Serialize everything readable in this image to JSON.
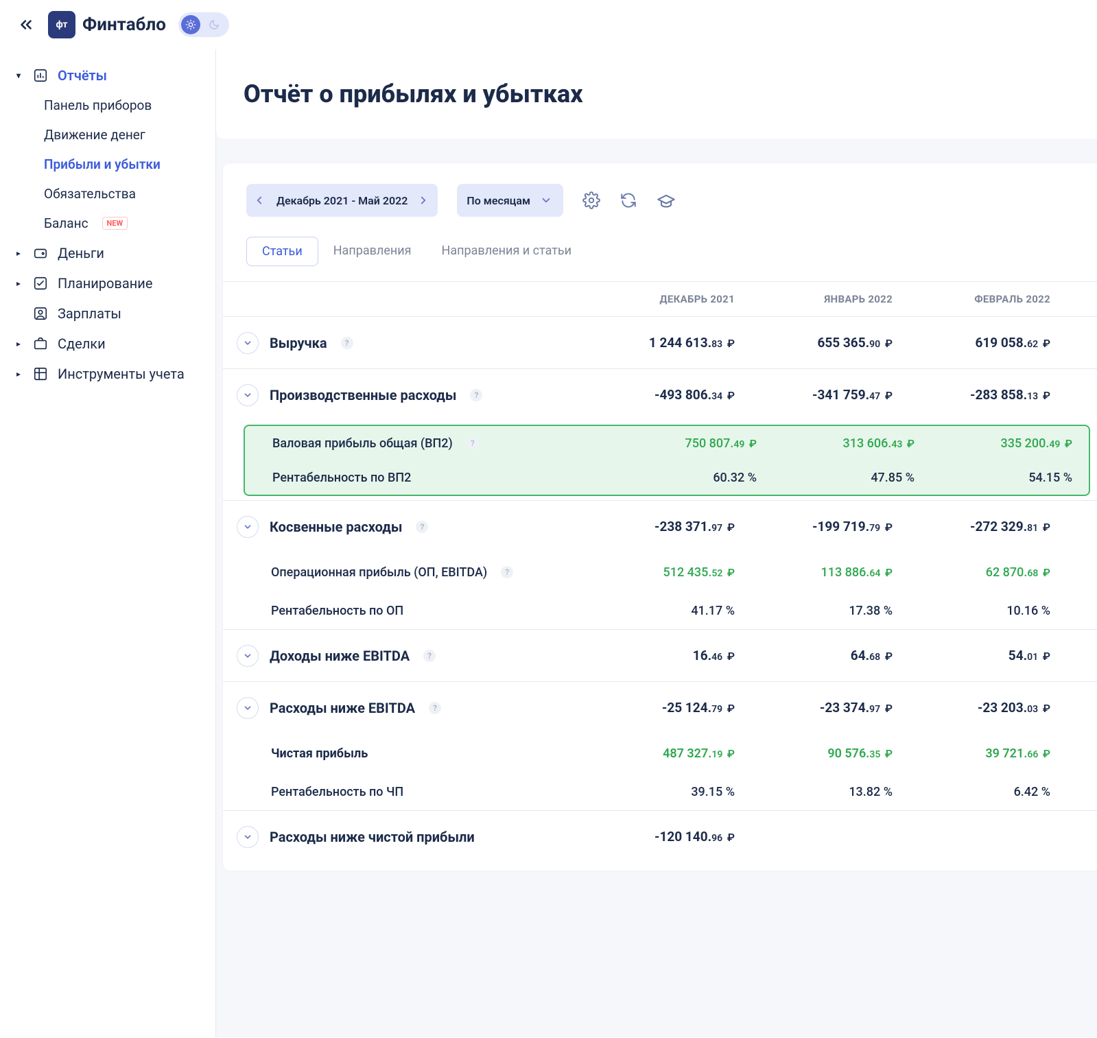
{
  "app": {
    "logo_short": "фт",
    "logo_text": "Финтабло"
  },
  "sidebar": {
    "reports": {
      "label": "Отчёты",
      "items": [
        {
          "label": "Панель приборов"
        },
        {
          "label": "Движение денег"
        },
        {
          "label": "Прибыли и убытки"
        },
        {
          "label": "Обязательства"
        },
        {
          "label": "Баланс",
          "badge": "NEW"
        }
      ]
    },
    "money": {
      "label": "Деньги"
    },
    "planning": {
      "label": "Планирование"
    },
    "salary": {
      "label": "Зарплаты"
    },
    "deals": {
      "label": "Сделки"
    },
    "tools": {
      "label": "Инструменты учета"
    }
  },
  "page": {
    "title": "Отчёт о прибылях и убытках"
  },
  "toolbar": {
    "period": "Декабрь 2021 - Май 2022",
    "granularity": "По месяцам"
  },
  "tabs": {
    "articles": "Статьи",
    "directions": "Направления",
    "both": "Направления и статьи"
  },
  "columns": [
    "ДЕКАБРЬ 2021",
    "ЯНВАРЬ 2022",
    "ФЕВРАЛЬ 2022"
  ],
  "currency": "₽",
  "rows": {
    "revenue": {
      "label": "Выручка",
      "help": true,
      "vals": [
        [
          "1 244 613",
          "83"
        ],
        [
          "655 365",
          "90"
        ],
        [
          "619 058",
          "62"
        ]
      ]
    },
    "prod_cost": {
      "label": "Производственные расходы",
      "help": true,
      "vals": [
        [
          "-493 806",
          "34"
        ],
        [
          "-341 759",
          "47"
        ],
        [
          "-283 858",
          "13"
        ]
      ]
    },
    "gross_profit": {
      "label": "Валовая прибыль общая (ВП2)",
      "help": true,
      "vals": [
        [
          "750 807",
          "49"
        ],
        [
          "313 606",
          "43"
        ],
        [
          "335 200",
          "49"
        ]
      ]
    },
    "gross_margin": {
      "label": "Рентабельность по ВП2",
      "pct": [
        "60.32",
        "47.85",
        "54.15"
      ]
    },
    "indirect": {
      "label": "Косвенные расходы",
      "help": true,
      "vals": [
        [
          "-238 371",
          "97"
        ],
        [
          "-199 719",
          "79"
        ],
        [
          "-272 329",
          "81"
        ]
      ]
    },
    "ebitda": {
      "label": "Операционная прибыль (ОП, EBITDA)",
      "help": true,
      "vals": [
        [
          "512 435",
          "52"
        ],
        [
          "113 886",
          "64"
        ],
        [
          "62 870",
          "68"
        ]
      ]
    },
    "op_margin": {
      "label": "Рентабельность по ОП",
      "pct": [
        "41.17",
        "17.38",
        "10.16"
      ]
    },
    "below_ebitda_inc": {
      "label": "Доходы ниже EBITDA",
      "help": true,
      "vals": [
        [
          "16",
          "46"
        ],
        [
          "64",
          "68"
        ],
        [
          "54",
          "01"
        ]
      ]
    },
    "below_ebitda_exp": {
      "label": "Расходы ниже EBITDA",
      "help": true,
      "vals": [
        [
          "-25 124",
          "79"
        ],
        [
          "-23 374",
          "97"
        ],
        [
          "-23 203",
          "03"
        ]
      ]
    },
    "net_profit": {
      "label": "Чистая прибыль",
      "vals": [
        [
          "487 327",
          "19"
        ],
        [
          "90 576",
          "35"
        ],
        [
          "39 721",
          "66"
        ]
      ]
    },
    "net_margin": {
      "label": "Рентабельность по ЧП",
      "pct": [
        "39.15",
        "13.82",
        "6.42"
      ]
    },
    "below_net_exp": {
      "label": "Расходы ниже чистой прибыли",
      "vals": [
        [
          "-120 140",
          "96"
        ],
        [
          "",
          ""
        ],
        [
          "",
          ""
        ]
      ]
    }
  }
}
